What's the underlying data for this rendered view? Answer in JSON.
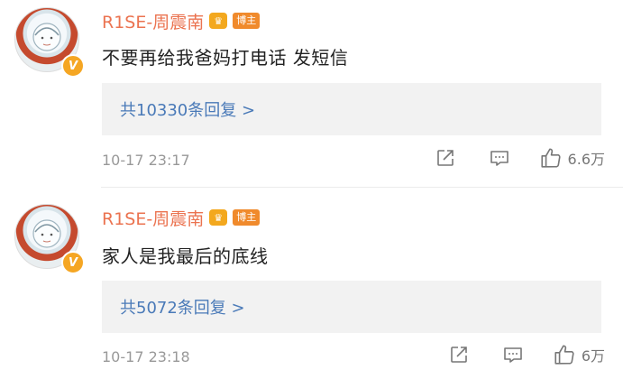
{
  "comments": [
    {
      "author": "R1SE-周震南",
      "vip_badge": "V",
      "crown_label": "♛",
      "role_badge": "博主",
      "text": "不要再给我爸妈打电话 发短信",
      "replies_label": "共10330条回复 >",
      "timestamp": "10-17 23:17",
      "likes": "6.6万"
    },
    {
      "author": "R1SE-周震南",
      "vip_badge": "V",
      "crown_label": "♛",
      "role_badge": "博主",
      "text": "家人是我最后的底线",
      "replies_label": "共5072条回复 >",
      "timestamp": "10-17 23:18",
      "likes": "6万"
    }
  ],
  "icons": {
    "share": "share-icon",
    "comment": "comment-icon",
    "like": "thumbs-up-icon"
  },
  "colors": {
    "author": "#eb7350",
    "replies_link": "#4a7ab8",
    "timestamp": "#999999"
  }
}
